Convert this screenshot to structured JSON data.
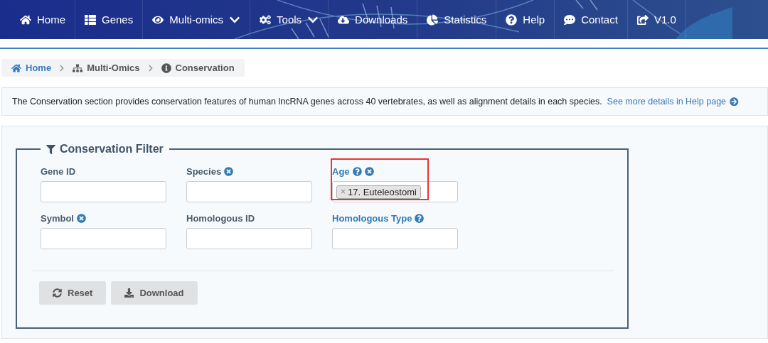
{
  "navbar": {
    "items": [
      {
        "label": "Home",
        "caret": false
      },
      {
        "label": "Genes",
        "caret": false
      },
      {
        "label": "Multi-omics",
        "caret": true
      },
      {
        "label": "Tools",
        "caret": true
      },
      {
        "label": "Downloads",
        "caret": false
      },
      {
        "label": "Statistics",
        "caret": false
      },
      {
        "label": "Help",
        "caret": false
      },
      {
        "label": "Contact",
        "caret": false
      },
      {
        "label": "V1.0",
        "caret": false
      }
    ]
  },
  "breadcrumb": [
    {
      "label": "Home",
      "link": true
    },
    {
      "label": "Multi-Omics",
      "link": false
    },
    {
      "label": "Conservation",
      "link": false
    }
  ],
  "intro": {
    "text": "The Conservation section provides conservation features of human lncRNA genes across 40 vertebrates, as well as alignment details in each species.",
    "link": "See more details in Help page"
  },
  "filter": {
    "title": "Conservation Filter",
    "fields": [
      {
        "label": "Gene ID",
        "color": "#4a5b6c",
        "help": false,
        "clear": false,
        "highlighted": false
      },
      {
        "label": "Species",
        "color": "#4a5b6c",
        "help": false,
        "clear": true,
        "highlighted": false
      },
      {
        "label": "Age",
        "color": "#337ab7",
        "help": true,
        "clear": true,
        "tags": [
          {
            "remove": "×",
            "label": "17. Euteleostomi"
          }
        ],
        "highlighted": true
      },
      {
        "label": "Symbol",
        "color": "#4a5b6c",
        "help": false,
        "clear": true,
        "highlighted": false
      },
      {
        "label": "Homologous ID",
        "color": "#4a5b6c",
        "help": false,
        "clear": false,
        "highlighted": false
      },
      {
        "label": "Homologous Type",
        "color": "#337ab7",
        "help": true,
        "clear": false,
        "highlighted": false
      }
    ],
    "buttons": [
      "Reset",
      "Download"
    ]
  }
}
